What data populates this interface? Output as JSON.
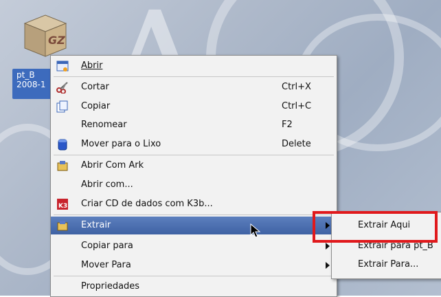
{
  "desktop": {
    "icon_text": "GZ",
    "file_label_line1": "pt_B",
    "file_label_line2": "2008-1"
  },
  "context_menu": {
    "items": [
      {
        "label": "Abrir",
        "shortcut": "",
        "icon": "open-icon"
      },
      {
        "label": "Cortar",
        "shortcut": "Ctrl+X",
        "icon": "scissors-icon"
      },
      {
        "label": "Copiar",
        "shortcut": "Ctrl+C",
        "icon": "copy-icon"
      },
      {
        "label": "Renomear",
        "shortcut": "F2",
        "icon": ""
      },
      {
        "label": "Mover para o Lixo",
        "shortcut": "Delete",
        "icon": "trash-icon"
      },
      {
        "label": "Abrir Com Ark",
        "shortcut": "",
        "icon": "ark-icon"
      },
      {
        "label": "Abrir com...",
        "shortcut": "",
        "icon": ""
      },
      {
        "label": "Criar CD de dados com K3b...",
        "shortcut": "",
        "icon": "k3b-icon"
      },
      {
        "label": "Extrair",
        "shortcut": "",
        "icon": "ark-icon"
      },
      {
        "label": "Copiar para",
        "shortcut": "",
        "icon": ""
      },
      {
        "label": "Mover Para",
        "shortcut": "",
        "icon": ""
      },
      {
        "label": "Propriedades",
        "shortcut": "",
        "icon": ""
      }
    ]
  },
  "submenu": {
    "items": [
      {
        "label": "Extrair Aqui"
      },
      {
        "label": "Extrair para pt_B"
      },
      {
        "label": "Extrair Para..."
      }
    ]
  },
  "colors": {
    "menu_highlight": "#4a6db0",
    "annotation_box": "#e0191c"
  }
}
